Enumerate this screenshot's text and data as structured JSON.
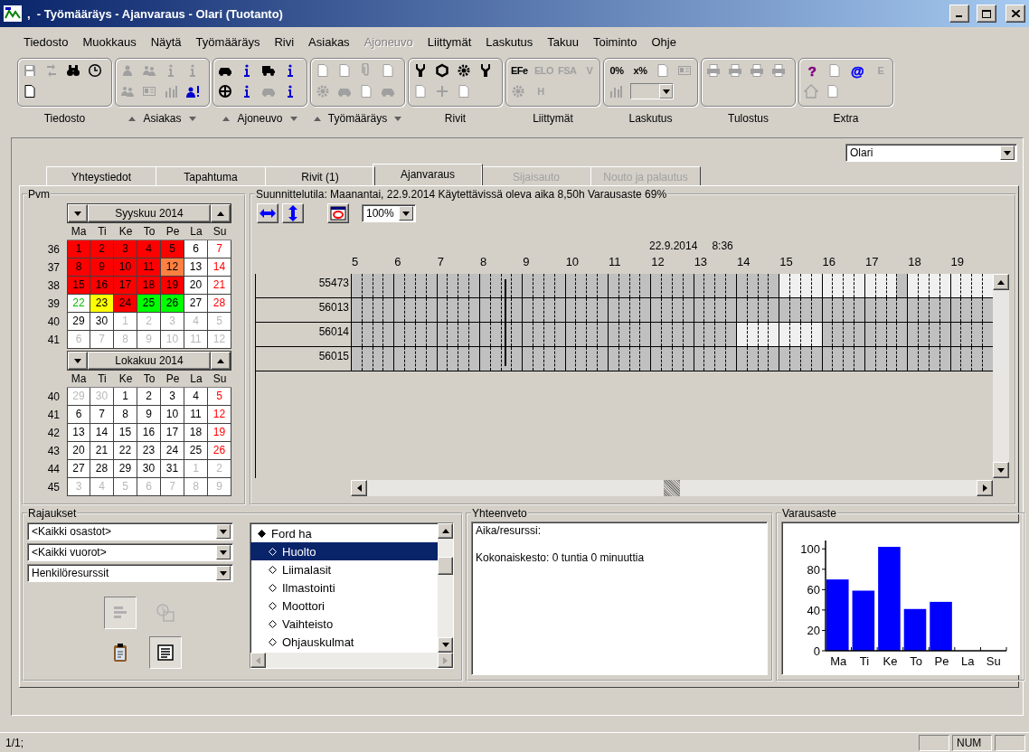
{
  "window": {
    "title": ",  - Työmääräys - Ajanvaraus - Olari (Tuotanto)"
  },
  "menu": [
    {
      "label": "Tiedosto",
      "disabled": false
    },
    {
      "label": "Muokkaus",
      "disabled": false
    },
    {
      "label": "Näytä",
      "disabled": false
    },
    {
      "label": "Työmääräys",
      "disabled": false
    },
    {
      "label": "Rivi",
      "disabled": false
    },
    {
      "label": "Asiakas",
      "disabled": false
    },
    {
      "label": "Ajoneuvo",
      "disabled": true
    },
    {
      "label": "Liittymät",
      "disabled": false
    },
    {
      "label": "Laskutus",
      "disabled": false
    },
    {
      "label": "Takuu",
      "disabled": false
    },
    {
      "label": "Toiminto",
      "disabled": false
    },
    {
      "label": "Ohje",
      "disabled": false
    }
  ],
  "toolbar": {
    "groups": [
      {
        "label": "Tiedosto",
        "arrows": false,
        "rows": [
          [
            {
              "kind": "icon",
              "disabled": true
            },
            {
              "kind": "icon",
              "disabled": true
            },
            {
              "kind": "icon",
              "disabled": false
            },
            {
              "kind": "icon",
              "disabled": false
            }
          ],
          [
            {
              "kind": "icon",
              "disabled": false
            }
          ]
        ]
      },
      {
        "label": "Asiakas",
        "arrows": true,
        "rows": [
          [
            {
              "kind": "icon",
              "disabled": true
            },
            {
              "kind": "icon",
              "disabled": true
            },
            {
              "kind": "icon",
              "disabled": true
            },
            {
              "kind": "icon",
              "disabled": true
            }
          ],
          [
            {
              "kind": "icon",
              "disabled": true
            },
            {
              "kind": "icon",
              "disabled": true
            },
            {
              "kind": "icon",
              "disabled": true
            },
            {
              "kind": "icon",
              "disabled": false
            }
          ]
        ]
      },
      {
        "label": "Ajoneuvo",
        "arrows": true,
        "rows": [
          [
            {
              "kind": "icon",
              "disabled": false
            },
            {
              "kind": "icon",
              "disabled": false
            },
            {
              "kind": "icon",
              "disabled": false
            },
            {
              "kind": "icon",
              "disabled": false
            }
          ],
          [
            {
              "kind": "icon",
              "disabled": false
            },
            {
              "kind": "icon",
              "disabled": false
            },
            {
              "kind": "icon",
              "disabled": true
            },
            {
              "kind": "icon",
              "disabled": false
            }
          ]
        ]
      },
      {
        "label": "Työmääräys",
        "arrows": true,
        "rows": [
          [
            {
              "kind": "icon",
              "disabled": true
            },
            {
              "kind": "icon",
              "disabled": true
            },
            {
              "kind": "icon",
              "disabled": true
            },
            {
              "kind": "icon",
              "disabled": true
            }
          ],
          [
            {
              "kind": "icon",
              "disabled": true
            },
            {
              "kind": "icon",
              "disabled": true
            },
            {
              "kind": "icon",
              "disabled": true
            },
            {
              "kind": "icon",
              "disabled": true
            }
          ]
        ]
      },
      {
        "label": "Rivit",
        "arrows": false,
        "rows": [
          [
            {
              "kind": "icon",
              "disabled": false
            },
            {
              "kind": "icon",
              "disabled": false
            },
            {
              "kind": "icon",
              "disabled": false
            },
            {
              "kind": "icon",
              "disabled": false
            }
          ],
          [
            {
              "kind": "icon",
              "disabled": true
            },
            {
              "kind": "icon",
              "disabled": true
            },
            {
              "kind": "icon",
              "disabled": true
            }
          ]
        ]
      },
      {
        "label": "Liittymät",
        "arrows": false,
        "rows": [
          [
            {
              "kind": "text",
              "text": "EFe",
              "disabled": false
            },
            {
              "kind": "text",
              "text": "ELO",
              "disabled": true
            },
            {
              "kind": "text",
              "text": "FSA",
              "disabled": true
            },
            {
              "kind": "text",
              "text": "V",
              "disabled": true
            }
          ],
          [
            {
              "kind": "icon",
              "disabled": true
            },
            {
              "kind": "text",
              "text": "H",
              "disabled": true
            }
          ]
        ]
      },
      {
        "label": "Laskutus",
        "arrows": false,
        "rows": [
          [
            {
              "kind": "text",
              "text": "0%",
              "disabled": false
            },
            {
              "kind": "text",
              "text": "x%",
              "disabled": false
            },
            {
              "kind": "icon",
              "disabled": true
            },
            {
              "kind": "icon",
              "disabled": true
            }
          ],
          [
            {
              "kind": "icon",
              "disabled": true
            },
            {
              "kind": "combo",
              "disabled": true
            }
          ]
        ]
      },
      {
        "label": "Tulostus",
        "arrows": false,
        "rows": [
          [
            {
              "kind": "icon",
              "disabled": true
            },
            {
              "kind": "icon",
              "disabled": true
            },
            {
              "kind": "icon",
              "disabled": true
            },
            {
              "kind": "icon",
              "disabled": true
            }
          ]
        ]
      },
      {
        "label": "Extra",
        "arrows": false,
        "rows": [
          [
            {
              "kind": "text",
              "text": "?",
              "disabled": false,
              "color": "#800080"
            },
            {
              "kind": "icon",
              "disabled": true
            },
            {
              "kind": "text",
              "text": "@",
              "disabled": false,
              "color": "#0000ff"
            },
            {
              "kind": "text",
              "text": "E",
              "disabled": true
            }
          ],
          [
            {
              "kind": "icon",
              "disabled": true
            },
            {
              "kind": "icon",
              "disabled": true
            }
          ]
        ]
      }
    ]
  },
  "location": "Olari",
  "tabs": [
    {
      "label": "Yhteystiedot",
      "selected": false,
      "disabled": false
    },
    {
      "label": "Tapahtuma",
      "selected": false,
      "disabled": false
    },
    {
      "label": "Rivit (1)",
      "selected": false,
      "disabled": false
    },
    {
      "label": "Ajanvaraus",
      "selected": true,
      "disabled": false
    },
    {
      "label": "Sijaisauto",
      "selected": false,
      "disabled": true
    },
    {
      "label": "Nouto ja palautus",
      "selected": false,
      "disabled": true
    }
  ],
  "calendar": {
    "title": "Pvm",
    "months": [
      {
        "title": "Syyskuu 2014",
        "weekdays": [
          "Ma",
          "Ti",
          "Ke",
          "To",
          "Pe",
          "La",
          "Su"
        ],
        "weeks": [
          {
            "week": "36",
            "days": [
              {
                "d": "1",
                "color": "#ff0000",
                "kind": "day"
              },
              {
                "d": "2",
                "color": "#ff0000",
                "kind": "day"
              },
              {
                "d": "3",
                "color": "#ff0000",
                "kind": "day"
              },
              {
                "d": "4",
                "color": "#ff0000",
                "kind": "day"
              },
              {
                "d": "5",
                "color": "#ff0000",
                "kind": "day"
              },
              {
                "d": "6",
                "color": "#ffffff",
                "kind": "day"
              },
              {
                "d": "7",
                "color": "#ffffff",
                "kind": "sunday"
              }
            ]
          },
          {
            "week": "37",
            "days": [
              {
                "d": "8",
                "color": "#ff0000",
                "kind": "day"
              },
              {
                "d": "9",
                "color": "#ff0000",
                "kind": "day"
              },
              {
                "d": "10",
                "color": "#ff0000",
                "kind": "day"
              },
              {
                "d": "11",
                "color": "#ff0000",
                "kind": "day"
              },
              {
                "d": "12",
                "color": "#ff8040",
                "kind": "day"
              },
              {
                "d": "13",
                "color": "#ffffff",
                "kind": "day"
              },
              {
                "d": "14",
                "color": "#ffffff",
                "kind": "sunday"
              }
            ]
          },
          {
            "week": "38",
            "days": [
              {
                "d": "15",
                "color": "#ff0000",
                "kind": "day"
              },
              {
                "d": "16",
                "color": "#ff0000",
                "kind": "day"
              },
              {
                "d": "17",
                "color": "#ff0000",
                "kind": "day"
              },
              {
                "d": "18",
                "color": "#ff0000",
                "kind": "day"
              },
              {
                "d": "19",
                "color": "#ff0000",
                "kind": "day"
              },
              {
                "d": "20",
                "color": "#ffffff",
                "kind": "day"
              },
              {
                "d": "21",
                "color": "#ffffff",
                "kind": "sunday"
              }
            ]
          },
          {
            "week": "39",
            "days": [
              {
                "d": "22",
                "color": "#ffffff",
                "kind": "today"
              },
              {
                "d": "23",
                "color": "#ffff00",
                "kind": "day"
              },
              {
                "d": "24",
                "color": "#ff0000",
                "kind": "day"
              },
              {
                "d": "25",
                "color": "#00ff00",
                "kind": "day"
              },
              {
                "d": "26",
                "color": "#00ff00",
                "kind": "day"
              },
              {
                "d": "27",
                "color": "#ffffff",
                "kind": "day"
              },
              {
                "d": "28",
                "color": "#ffffff",
                "kind": "sunday"
              }
            ]
          },
          {
            "week": "40",
            "days": [
              {
                "d": "29",
                "color": "#ffffff",
                "kind": "day"
              },
              {
                "d": "30",
                "color": "#ffffff",
                "kind": "day"
              },
              {
                "d": "1",
                "color": "#ffffff",
                "kind": "other"
              },
              {
                "d": "2",
                "color": "#ffffff",
                "kind": "other"
              },
              {
                "d": "3",
                "color": "#ffffff",
                "kind": "other"
              },
              {
                "d": "4",
                "color": "#ffffff",
                "kind": "other"
              },
              {
                "d": "5",
                "color": "#ffffff",
                "kind": "other"
              }
            ]
          },
          {
            "week": "41",
            "days": [
              {
                "d": "6",
                "color": "#ffffff",
                "kind": "other"
              },
              {
                "d": "7",
                "color": "#ffffff",
                "kind": "other"
              },
              {
                "d": "8",
                "color": "#ffffff",
                "kind": "other"
              },
              {
                "d": "9",
                "color": "#ffffff",
                "kind": "other"
              },
              {
                "d": "10",
                "color": "#ffffff",
                "kind": "other"
              },
              {
                "d": "11",
                "color": "#ffffff",
                "kind": "other"
              },
              {
                "d": "12",
                "color": "#ffffff",
                "kind": "other"
              }
            ]
          }
        ]
      },
      {
        "title": "Lokakuu 2014",
        "weekdays": [
          "Ma",
          "Ti",
          "Ke",
          "To",
          "Pe",
          "La",
          "Su"
        ],
        "weeks": [
          {
            "week": "40",
            "days": [
              {
                "d": "29",
                "color": "#ffffff",
                "kind": "other"
              },
              {
                "d": "30",
                "color": "#ffffff",
                "kind": "other"
              },
              {
                "d": "1",
                "color": "#ffffff",
                "kind": "day"
              },
              {
                "d": "2",
                "color": "#ffffff",
                "kind": "day"
              },
              {
                "d": "3",
                "color": "#ffffff",
                "kind": "day"
              },
              {
                "d": "4",
                "color": "#ffffff",
                "kind": "day"
              },
              {
                "d": "5",
                "color": "#ffffff",
                "kind": "sunday"
              }
            ]
          },
          {
            "week": "41",
            "days": [
              {
                "d": "6",
                "color": "#ffffff",
                "kind": "day"
              },
              {
                "d": "7",
                "color": "#ffffff",
                "kind": "day"
              },
              {
                "d": "8",
                "color": "#ffffff",
                "kind": "day"
              },
              {
                "d": "9",
                "color": "#ffffff",
                "kind": "day"
              },
              {
                "d": "10",
                "color": "#ffffff",
                "kind": "day"
              },
              {
                "d": "11",
                "color": "#ffffff",
                "kind": "day"
              },
              {
                "d": "12",
                "color": "#ffffff",
                "kind": "sunday"
              }
            ]
          },
          {
            "week": "42",
            "days": [
              {
                "d": "13",
                "color": "#ffffff",
                "kind": "day"
              },
              {
                "d": "14",
                "color": "#ffffff",
                "kind": "day"
              },
              {
                "d": "15",
                "color": "#ffffff",
                "kind": "day"
              },
              {
                "d": "16",
                "color": "#ffffff",
                "kind": "day"
              },
              {
                "d": "17",
                "color": "#ffffff",
                "kind": "day"
              },
              {
                "d": "18",
                "color": "#ffffff",
                "kind": "day"
              },
              {
                "d": "19",
                "color": "#ffffff",
                "kind": "sunday"
              }
            ]
          },
          {
            "week": "43",
            "days": [
              {
                "d": "20",
                "color": "#ffffff",
                "kind": "day"
              },
              {
                "d": "21",
                "color": "#ffffff",
                "kind": "day"
              },
              {
                "d": "22",
                "color": "#ffffff",
                "kind": "day"
              },
              {
                "d": "23",
                "color": "#ffffff",
                "kind": "day"
              },
              {
                "d": "24",
                "color": "#ffffff",
                "kind": "day"
              },
              {
                "d": "25",
                "color": "#ffffff",
                "kind": "day"
              },
              {
                "d": "26",
                "color": "#ffffff",
                "kind": "sunday"
              }
            ]
          },
          {
            "week": "44",
            "days": [
              {
                "d": "27",
                "color": "#ffffff",
                "kind": "day"
              },
              {
                "d": "28",
                "color": "#ffffff",
                "kind": "day"
              },
              {
                "d": "29",
                "color": "#ffffff",
                "kind": "day"
              },
              {
                "d": "30",
                "color": "#ffffff",
                "kind": "day"
              },
              {
                "d": "31",
                "color": "#ffffff",
                "kind": "day"
              },
              {
                "d": "1",
                "color": "#ffffff",
                "kind": "other"
              },
              {
                "d": "2",
                "color": "#ffffff",
                "kind": "other"
              }
            ]
          },
          {
            "week": "45",
            "days": [
              {
                "d": "3",
                "color": "#ffffff",
                "kind": "other"
              },
              {
                "d": "4",
                "color": "#ffffff",
                "kind": "other"
              },
              {
                "d": "5",
                "color": "#ffffff",
                "kind": "other"
              },
              {
                "d": "6",
                "color": "#ffffff",
                "kind": "other"
              },
              {
                "d": "7",
                "color": "#ffffff",
                "kind": "other"
              },
              {
                "d": "8",
                "color": "#ffffff",
                "kind": "other"
              },
              {
                "d": "9",
                "color": "#ffffff",
                "kind": "other"
              }
            ]
          }
        ]
      }
    ]
  },
  "schedule": {
    "title": "Suunnittelutila: Maanantai, 22.9.2014 Käytettävissä oleva aika 8,50h Varausaste 69%",
    "zoom": "100%",
    "date": "22.9.2014",
    "time": "8:36",
    "hours": [
      "5",
      "6",
      "7",
      "8",
      "9",
      "10",
      "11",
      "12",
      "13",
      "14",
      "15",
      "16",
      "17",
      "18",
      "19"
    ],
    "marker": {
      "level": 0.24
    },
    "rows": [
      {
        "label": "55473",
        "free": [
          [
            false,
            false,
            false,
            false
          ],
          [
            false,
            false,
            false,
            false
          ],
          [
            false,
            false,
            false,
            false
          ],
          [
            false,
            false,
            false,
            false
          ],
          [
            false,
            false,
            false,
            false
          ],
          [
            false,
            false,
            false,
            false
          ],
          [
            false,
            false,
            false,
            false
          ],
          [
            false,
            false,
            false,
            false
          ],
          [
            false,
            false,
            false,
            false
          ],
          [
            false,
            false,
            false,
            false
          ],
          [
            true,
            true,
            true,
            true
          ],
          [
            true,
            true,
            true,
            true
          ],
          [
            true,
            true,
            true,
            false
          ],
          [
            true,
            true,
            true,
            true
          ],
          [
            true,
            true,
            true,
            true
          ]
        ]
      },
      {
        "label": "56013",
        "free": [
          [
            false,
            false,
            false,
            false
          ],
          [
            false,
            false,
            false,
            false
          ],
          [
            false,
            false,
            false,
            false
          ],
          [
            false,
            false,
            false,
            false
          ],
          [
            false,
            false,
            false,
            false
          ],
          [
            false,
            false,
            false,
            false
          ],
          [
            false,
            false,
            false,
            false
          ],
          [
            false,
            false,
            false,
            false
          ],
          [
            false,
            false,
            false,
            false
          ],
          [
            false,
            false,
            false,
            false
          ],
          [
            false,
            false,
            false,
            false
          ],
          [
            false,
            false,
            false,
            false
          ],
          [
            false,
            false,
            false,
            false
          ],
          [
            false,
            false,
            false,
            false
          ],
          [
            false,
            false,
            false,
            false
          ]
        ]
      },
      {
        "label": "56014",
        "free": [
          [
            false,
            false,
            false,
            false
          ],
          [
            false,
            false,
            false,
            false
          ],
          [
            false,
            false,
            false,
            false
          ],
          [
            false,
            false,
            false,
            false
          ],
          [
            false,
            false,
            false,
            false
          ],
          [
            false,
            false,
            false,
            false
          ],
          [
            false,
            false,
            false,
            false
          ],
          [
            false,
            false,
            false,
            false
          ],
          [
            false,
            false,
            false,
            false
          ],
          [
            true,
            true,
            true,
            true
          ],
          [
            true,
            true,
            true,
            true
          ],
          [
            false,
            false,
            false,
            false
          ],
          [
            false,
            false,
            false,
            false
          ],
          [
            false,
            false,
            false,
            false
          ],
          [
            false,
            false,
            false,
            false
          ]
        ]
      },
      {
        "label": "56015",
        "free": [
          [
            false,
            false,
            false,
            false
          ],
          [
            false,
            false,
            false,
            false
          ],
          [
            false,
            false,
            false,
            false
          ],
          [
            false,
            false,
            false,
            false
          ],
          [
            false,
            false,
            false,
            false
          ],
          [
            false,
            false,
            false,
            false
          ],
          [
            false,
            false,
            false,
            false
          ],
          [
            false,
            false,
            false,
            false
          ],
          [
            false,
            false,
            false,
            false
          ],
          [
            false,
            false,
            false,
            false
          ],
          [
            false,
            false,
            false,
            false
          ],
          [
            false,
            false,
            false,
            false
          ],
          [
            false,
            false,
            false,
            false
          ],
          [
            false,
            false,
            false,
            false
          ],
          [
            false,
            false,
            false,
            false
          ]
        ]
      }
    ]
  },
  "filters": {
    "title": "Rajaukset",
    "dropdowns": [
      "<Kaikki osastot>",
      "<Kaikki vuorot>",
      "Henkilöresurssit"
    ],
    "buttons": [
      {
        "pressed": true,
        "disabled": true
      },
      {
        "pressed": false,
        "disabled": true
      },
      {
        "pressed": false,
        "disabled": false
      },
      {
        "pressed": true,
        "disabled": false
      }
    ],
    "tree": [
      {
        "label": "Ford ha",
        "selected": false,
        "children": [
          {
            "label": "Huolto",
            "selected": true
          },
          {
            "label": "Liimalasit",
            "selected": false
          },
          {
            "label": "Ilmastointi",
            "selected": false
          },
          {
            "label": "Moottori",
            "selected": false
          },
          {
            "label": "Vaihteisto",
            "selected": false
          },
          {
            "label": "Ohjauskulmat",
            "selected": false
          }
        ]
      }
    ]
  },
  "summary": {
    "title": "Yhteenveto",
    "heading": "Aika/resurssi:",
    "total": "Kokonaiskesto: 0 tuntia 0 minuuttia"
  },
  "utilization": {
    "title": "Varausaste",
    "chart_data": {
      "type": "bar",
      "categories": [
        "Ma",
        "Ti",
        "Ke",
        "To",
        "Pe",
        "La",
        "Su"
      ],
      "series": [
        {
          "color": "#0000ff",
          "values": [
            70,
            59,
            102,
            41,
            48,
            null,
            null
          ]
        }
      ],
      "ylim": [
        0,
        110
      ],
      "yticks": [
        0,
        20,
        40,
        60,
        80,
        100
      ]
    }
  },
  "status_bar": {
    "text": "1/1;",
    "indicators": [
      "NUM"
    ]
  }
}
